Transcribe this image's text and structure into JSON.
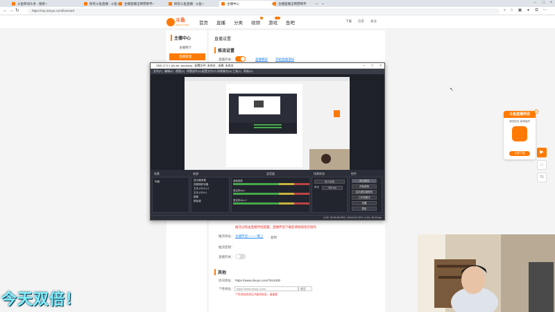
{
  "browser": {
    "tabs": [
      {
        "title": "斗鱼移动头条 - 搜索"
      },
      {
        "title": "探究斗鱼直播 - 斗鱼"
      },
      {
        "title": "主播直播全网营销平"
      },
      {
        "title": "探究斗鱼直播 - 斗鱼"
      },
      {
        "title": "主播中心"
      },
      {
        "title": "主播直播全网营销平"
      }
    ],
    "url": "https://mp.douyu.com/live/card"
  },
  "douyu": {
    "logo_main": "斗鱼",
    "logo_sub": "DOUYU.COM",
    "nav": [
      "首页",
      "直播",
      "分类",
      "视频",
      "游戏",
      "鱼吧"
    ],
    "header_right": [
      "下载",
      "历史",
      "关注"
    ]
  },
  "sidebar": {
    "title": "主播中心",
    "items": [
      {
        "label": "主播简介"
      },
      {
        "label": "直播管理"
      }
    ]
  },
  "main": {
    "page_title": "直播设置",
    "section1": "推流设置",
    "push_label": "直播开关：",
    "link1": "直播教程",
    "link2": "开始直播须知",
    "red_note": "推流过程由直播伴侣配置，直播伴侣下载后请按照指示操作",
    "row_label1": "推流地址：",
    "row_link1": "主播伴侣——一键上",
    "row_btn1": "复制",
    "row_label2": "推流密钥：",
    "row_label3": "直播开关：",
    "section2": "其他",
    "room_label": "房间地址：",
    "room_url": "https://www.douyu.com/7914000",
    "custom_label": "个性地址：",
    "custom_prefix": "https://www.douyu.com/",
    "custom_btn": "确定",
    "custom_note": "个性地址修改后不能再修改，请谨慎"
  },
  "obs": {
    "title": "OBS 27.0.1 (64-bit, windows) - 配置文件: 未命名 - 场景: 未命名",
    "menu": [
      "文件(F)",
      "编辑(E)",
      "视图(V)",
      "停靠部件(D)",
      "配置文件(P)",
      "场景集合(S)",
      "工具(T)",
      "帮助(H)"
    ],
    "docks": {
      "scenes_title": "场景",
      "scene_item": "场景",
      "sources_title": "来源",
      "sources": [
        "显示器采集",
        "视频捕获设备",
        "文本 (GDI+) 2",
        "文本 (GDI+)",
        "图像",
        "颜色源"
      ],
      "mixer_title": "混音器",
      "mixer": [
        "桌面音频",
        "麦克风/Aux",
        "麦克风/Aux 2"
      ],
      "transitions_title": "场景转场",
      "transition_value": "淡入淡出",
      "duration_label": "时长",
      "duration_value": "300 ms",
      "controls_title": "控件",
      "controls": [
        "停止推流",
        "开始录制",
        "启动虚拟摄像机",
        "工作室模式",
        "设置",
        "退出"
      ]
    },
    "status": "LIVE: 00:09:56   REC: 00:00:00   CPU: 3.4%, 30.00 fps"
  },
  "overlay_text": "今天双倍！",
  "ad": {
    "title": "斗鱼直播伴侣",
    "line1": "超低延迟 高清画质",
    "button": "立即下载"
  },
  "colors": {
    "brand": "#ff7a00",
    "link": "#2b8bf2",
    "obs_bg": "#2b2e38"
  }
}
